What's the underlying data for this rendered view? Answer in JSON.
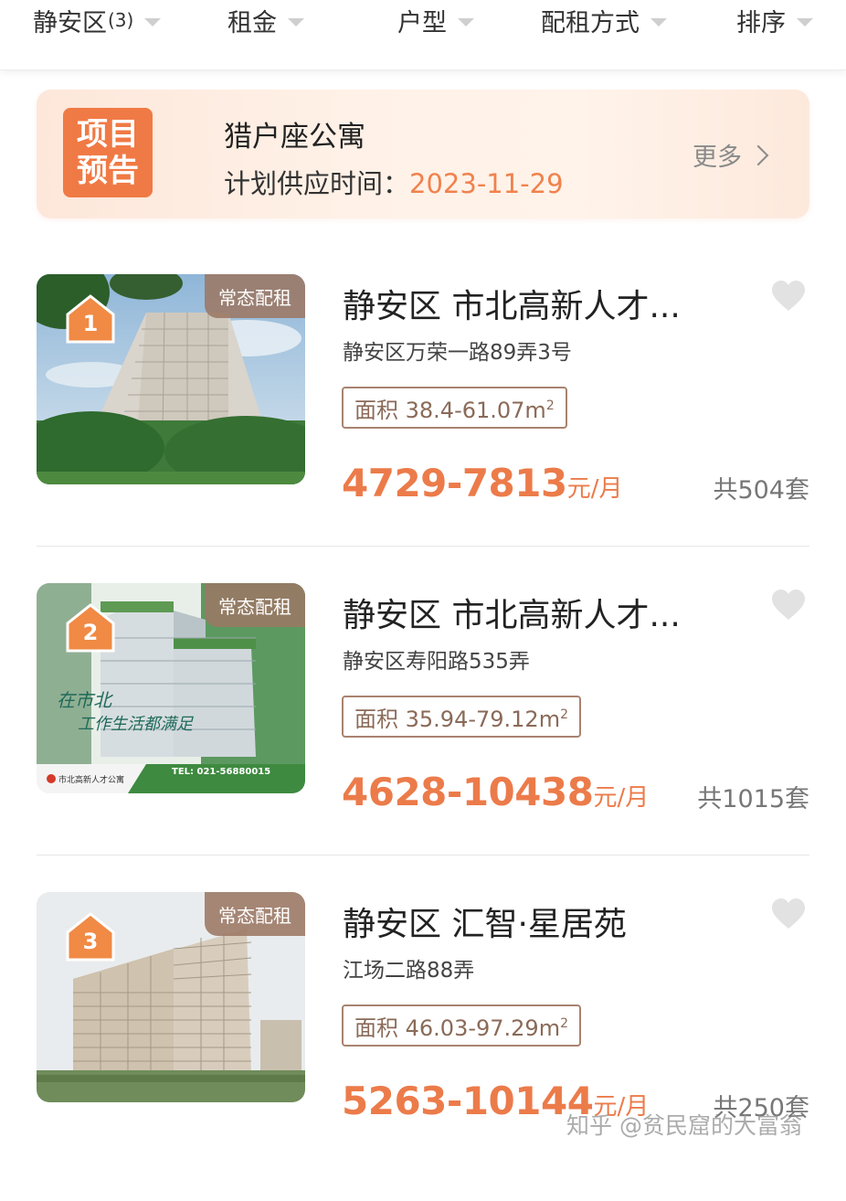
{
  "filters": [
    {
      "label": "静安区",
      "count": "(3)"
    },
    {
      "label": "租金",
      "count": ""
    },
    {
      "label": "户型",
      "count": ""
    },
    {
      "label": "配租方式",
      "count": ""
    },
    {
      "label": "排序",
      "count": ""
    }
  ],
  "banner": {
    "badge_line1": "项目",
    "badge_line2": "预告",
    "title": "猎户座公寓",
    "time_label": "计划供应时间：",
    "time_value": "2023-11-29",
    "more_label": "更多"
  },
  "listings": [
    {
      "rank": "1",
      "tag": "常态配租",
      "title": "静安区 市北高新人才...",
      "address": "静安区万荣一路89弄3号",
      "area_label": "面积 38.4-61.07m",
      "area_sup": "2",
      "price": "4729-7813",
      "price_unit": "元/月",
      "total": "共504套"
    },
    {
      "rank": "2",
      "tag": "常态配租",
      "title": "静安区 市北高新人才...",
      "address": "静安区寿阳路535弄",
      "area_label": "面积 35.94-79.12m",
      "area_sup": "2",
      "price": "4628-10438",
      "price_unit": "元/月",
      "total": "共1015套",
      "image_text": {
        "slogan1": "在市北",
        "slogan2": "工作生活都满足",
        "brand": "市北高新人才公寓",
        "tel": "TEL: 021-56880015"
      }
    },
    {
      "rank": "3",
      "tag": "常态配租",
      "title": "静安区 汇智·星居苑",
      "address": "江场二路88弄",
      "area_label": "面积 46.03-97.29m",
      "area_sup": "2",
      "price": "5263-10144",
      "price_unit": "元/月",
      "total": "共250套"
    }
  ],
  "watermark": "知乎 @贫民窟的大富翁",
  "colors": {
    "accent": "#ec7b4a",
    "badge": "#f07a45",
    "tag_bg": "#9b7864",
    "area_border": "#a9826f"
  }
}
